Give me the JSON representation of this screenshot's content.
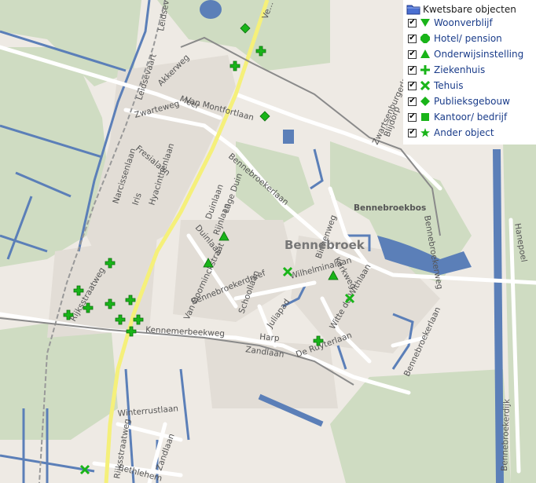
{
  "legend": {
    "title": "Kwetsbare objecten",
    "items": [
      {
        "label": "Woonverblijf",
        "icon": "triangle-down-icon",
        "checked": true
      },
      {
        "label": "Hotel/ pension",
        "icon": "octagon-icon",
        "checked": true
      },
      {
        "label": "Onderwijsinstelling",
        "icon": "triangle-up-icon",
        "checked": true
      },
      {
        "label": "Ziekenhuis",
        "icon": "plus-icon",
        "checked": true
      },
      {
        "label": "Tehuis",
        "icon": "x-icon",
        "checked": true
      },
      {
        "label": "Publieksgebouw",
        "icon": "diamond-icon",
        "checked": true
      },
      {
        "label": "Kantoor/ bedrijf",
        "icon": "square-icon",
        "checked": true
      },
      {
        "label": "Ander object",
        "icon": "star-icon",
        "checked": true
      }
    ],
    "symbol_color": "#19b419"
  },
  "town": "Bennebroek",
  "area_label": "Bennebroekbos",
  "streets": [
    "Leidsevaart",
    "Leidsevaart",
    "Rijksstraatweg",
    "Binnenweg",
    "Bennebroekerlaan",
    "Bennebroekerdreef",
    "Kennemerbeekweg",
    "Zwarteweg",
    "Zwartsenburgerlaan",
    "Blijdorp",
    "Fresialaan",
    "Zandlaan",
    "Harp",
    "Schoollaan",
    "Juliapad",
    "Wilhelminalaan",
    "Duinlaan",
    "Lage Duin",
    "Winterrustlaan",
    "De Ruyterlaan",
    "Bennebroekerdijk",
    "Hanepoel",
    "Meer",
    "Rijnlaan",
    "Duinlaan",
    "Narcissenlaan",
    "Iris",
    "Hyacinthenlaan",
    "Van Doorninckstraat",
    "Van Montfortlaan",
    "Akkerweg",
    "Ve...",
    "Kerkweg",
    "Witte de Withlaan",
    "Bethlehem",
    "Zandlaan",
    "Rijksstraatweg",
    "Bennebroekerlaan",
    "Bennebroekerweg"
  ],
  "colors": {
    "water": "#5b7fb8",
    "road_main": "#f5f07a",
    "road": "#ffffff",
    "green": "#c7d9b9",
    "border": "#8a8a8a",
    "land": "#eeeae4"
  }
}
